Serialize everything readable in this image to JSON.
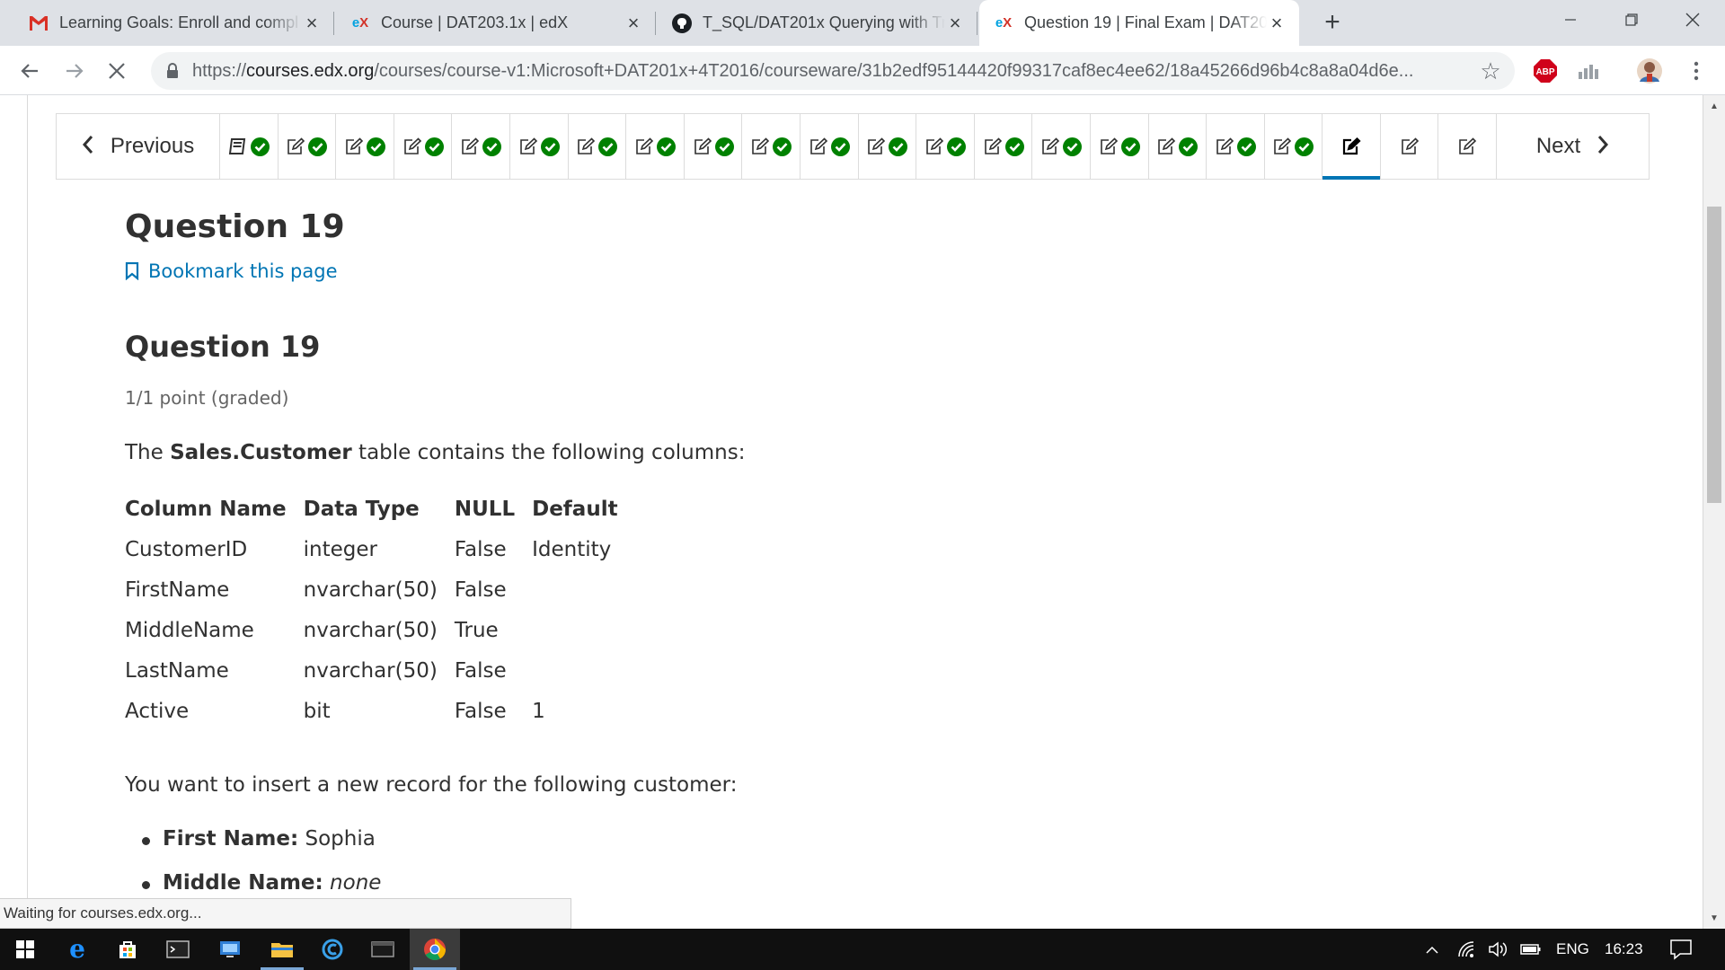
{
  "browser": {
    "tabs": [
      {
        "favicon": "M",
        "title": "Learning Goals: Enroll and compl"
      },
      {
        "favicon": "edX",
        "title": "Course | DAT203.1x | edX"
      },
      {
        "favicon": "github",
        "title": "T_SQL/DAT201x Querying with Tr"
      },
      {
        "favicon": "edX",
        "title": "Question 19 | Final Exam | DAT20"
      }
    ],
    "new_tab_label": "+",
    "url_scheme": "https://",
    "url_host": "courses.edx.org",
    "url_path": "/courses/course-v1:Microsoft+DAT201x+4T2016/courseware/31b2edf95144420f99317caf8ec4ee62/18a45266d96b4c8a8a04d6e...",
    "extensions": [
      "ABP"
    ]
  },
  "sequence": {
    "previous_label": "Previous",
    "next_label": "Next",
    "items": [
      {
        "icon": "book-icon",
        "completed": true
      },
      {
        "icon": "edit-icon",
        "completed": true
      },
      {
        "icon": "edit-icon",
        "completed": true
      },
      {
        "icon": "edit-icon",
        "completed": true
      },
      {
        "icon": "edit-icon",
        "completed": true
      },
      {
        "icon": "edit-icon",
        "completed": true
      },
      {
        "icon": "edit-icon",
        "completed": true
      },
      {
        "icon": "edit-icon",
        "completed": true
      },
      {
        "icon": "edit-icon",
        "completed": true
      },
      {
        "icon": "edit-icon",
        "completed": true
      },
      {
        "icon": "edit-icon",
        "completed": true
      },
      {
        "icon": "edit-icon",
        "completed": true
      },
      {
        "icon": "edit-icon",
        "completed": true
      },
      {
        "icon": "edit-icon",
        "completed": true
      },
      {
        "icon": "edit-icon",
        "completed": true
      },
      {
        "icon": "edit-icon",
        "completed": true
      },
      {
        "icon": "edit-icon",
        "completed": true
      },
      {
        "icon": "edit-icon",
        "completed": true
      },
      {
        "icon": "edit-icon",
        "completed": true
      },
      {
        "icon": "edit-icon",
        "completed": false,
        "active": true
      },
      {
        "icon": "edit-icon",
        "completed": false
      },
      {
        "icon": "edit-icon",
        "completed": false
      }
    ]
  },
  "unit": {
    "title": "Question 19",
    "bookmark_label": "Bookmark this page"
  },
  "problem": {
    "title": "Question 19",
    "points": "1/1 point (graded)",
    "intro_prefix": "The ",
    "intro_table": "Sales.Customer",
    "intro_suffix": " table contains the following columns:",
    "table_headers": [
      "Column Name",
      "Data Type",
      "NULL",
      "Default"
    ],
    "table_rows": [
      [
        "CustomerID",
        "integer",
        "False",
        "Identity"
      ],
      [
        "FirstName",
        "nvarchar(50)",
        "False",
        ""
      ],
      [
        "MiddleName",
        "nvarchar(50)",
        "True",
        ""
      ],
      [
        "LastName",
        "nvarchar(50)",
        "False",
        ""
      ],
      [
        "Active",
        "bit",
        "False",
        "1"
      ]
    ],
    "prompt": "You want to insert a new record for the following customer:",
    "customer": [
      {
        "label": "First Name:",
        "value": "Sophia",
        "italic": false
      },
      {
        "label": "Middle Name:",
        "value": "none",
        "italic": true
      }
    ]
  },
  "status_text": "Waiting for courses.edx.org...",
  "taskbar": {
    "language": "ENG",
    "time": "16:23"
  },
  "colors": {
    "edx_blue": "#0075b4",
    "check_green": "#008100",
    "gmail_red": "#d93025",
    "abp_red": "#d0021b"
  }
}
